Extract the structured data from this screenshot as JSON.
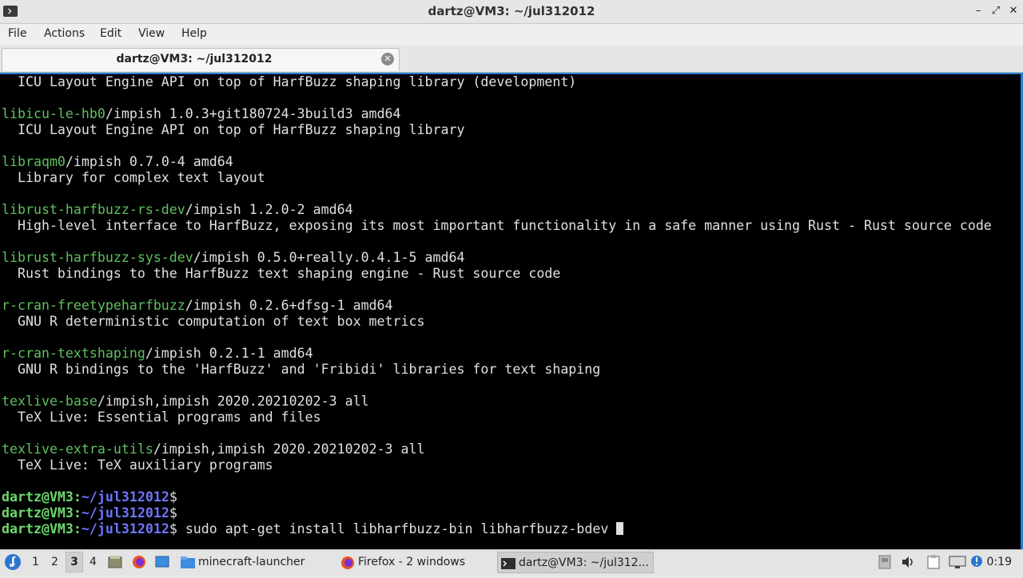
{
  "window": {
    "title": "dartz@VM3: ~/jul312012",
    "controls": [
      "–",
      "⤢",
      "✕"
    ]
  },
  "menu": [
    "File",
    "Actions",
    "Edit",
    "View",
    "Help"
  ],
  "tab": {
    "label": "dartz@VM3: ~/jul312012",
    "close": "✕"
  },
  "terminal": {
    "lines": [
      {
        "text": "  ICU Layout Engine API on top of HarfBuzz shaping library (development)"
      },
      {
        "text": ""
      },
      {
        "pkg": "libicu-le-hb0",
        "rest": "/impish 1.0.3+git180724-3build3 amd64"
      },
      {
        "text": "  ICU Layout Engine API on top of HarfBuzz shaping library"
      },
      {
        "text": ""
      },
      {
        "pkg": "libraqm0",
        "rest": "/impish 0.7.0-4 amd64"
      },
      {
        "text": "  Library for complex text layout"
      },
      {
        "text": ""
      },
      {
        "pkg": "librust-harfbuzz-rs-dev",
        "rest": "/impish 1.2.0-2 amd64"
      },
      {
        "text": "  High-level interface to HarfBuzz, exposing its most important functionality in a safe manner using Rust - Rust source code"
      },
      {
        "text": ""
      },
      {
        "pkg": "librust-harfbuzz-sys-dev",
        "rest": "/impish 0.5.0+really.0.4.1-5 amd64"
      },
      {
        "text": "  Rust bindings to the HarfBuzz text shaping engine - Rust source code"
      },
      {
        "text": ""
      },
      {
        "pkg": "r-cran-freetypeharfbuzz",
        "rest": "/impish 0.2.6+dfsg-1 amd64"
      },
      {
        "text": "  GNU R deterministic computation of text box metrics"
      },
      {
        "text": ""
      },
      {
        "pkg": "r-cran-textshaping",
        "rest": "/impish 0.2.1-1 amd64"
      },
      {
        "text": "  GNU R bindings to the 'HarfBuzz' and 'Fribidi' libraries for text shaping"
      },
      {
        "text": ""
      },
      {
        "pkg": "texlive-base",
        "rest": "/impish,impish 2020.20210202-3 all"
      },
      {
        "text": "  TeX Live: Essential programs and files"
      },
      {
        "text": ""
      },
      {
        "pkg": "texlive-extra-utils",
        "rest": "/impish,impish 2020.20210202-3 all"
      },
      {
        "text": "  TeX Live: TeX auxiliary programs"
      },
      {
        "text": ""
      },
      {
        "user": "dartz@VM3",
        "path": "~/jul312012",
        "cmd": ""
      },
      {
        "user": "dartz@VM3",
        "path": "~/jul312012",
        "cmd": ""
      },
      {
        "user": "dartz@VM3",
        "path": "~/jul312012",
        "cmd": " sudo apt-get install libharfbuzz-bin libharfbuzz-bdev ",
        "cursor": true
      }
    ]
  },
  "taskbar": {
    "start_icon": "start-menu-icon",
    "workspaces": [
      "1",
      "2",
      "3",
      "4"
    ],
    "active_workspace": "3",
    "tasks": [
      {
        "label": "minecraft-launcher",
        "icon": "folder-icon"
      },
      {
        "label": "Firefox - 2 windows",
        "icon": "firefox-icon"
      },
      {
        "label": "dartz@VM3: ~/jul312...",
        "icon": "terminal-icon",
        "active": true
      }
    ],
    "clock": "0:19"
  },
  "colors": {
    "terminal_bg": "#000000",
    "package_name": "#5fc05f",
    "prompt_user": "#6cd96c",
    "prompt_path": "#6f75ff",
    "focus_border": "#2a7fd4"
  }
}
